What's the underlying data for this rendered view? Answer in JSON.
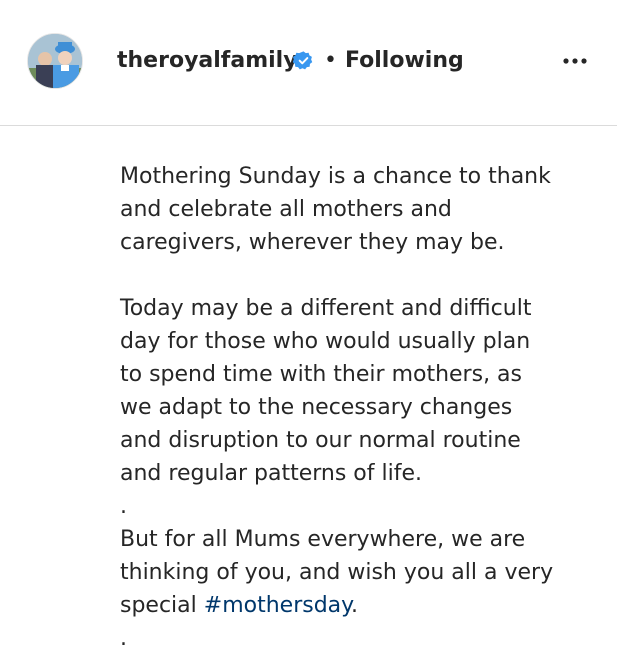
{
  "post": {
    "username": "theroyalfamily",
    "separator": "•",
    "follow_status": "Following",
    "colors": {
      "verified_badge": "#3897f0",
      "hashtag": "#00376b",
      "divider": "#dbdbdb",
      "text": "#262626"
    },
    "icons": {
      "verified": "verified-badge-icon",
      "more": "more-options-icon"
    }
  },
  "caption": {
    "p1_lines": [
      "Mothering Sunday is a chance to thank",
      "and celebrate all mothers and",
      "caregivers, wherever they may be."
    ],
    "p2_lines": [
      "Today may be a different and difficult",
      "day for those who would usually plan",
      "to spend time with their mothers, as",
      "we adapt to the necessary changes",
      "and disruption to our normal routine",
      "and regular patterns of life."
    ],
    "dot1": ".",
    "p3_lines": [
      "But for all Mums everywhere, we are",
      "thinking of you, and wish you all a very"
    ],
    "p3_last_prefix": "special ",
    "hashtag": "#mothersday",
    "p3_last_suffix": ".",
    "dot2": "."
  }
}
